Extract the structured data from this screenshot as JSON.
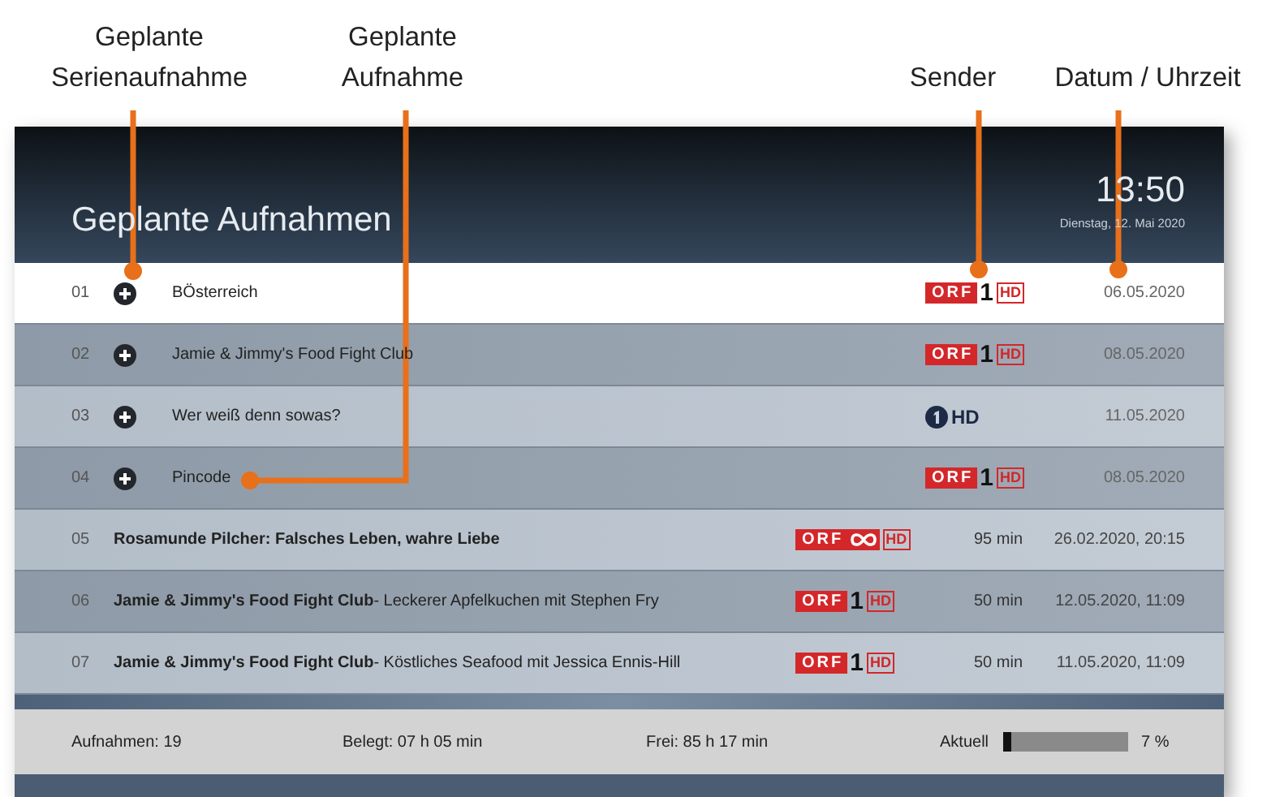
{
  "annotations": [
    {
      "label": "Geplante Serienaufnahme"
    },
    {
      "label": "Geplante Aufnahme"
    },
    {
      "label": "Sender"
    },
    {
      "label": "Datum / Uhrzeit"
    }
  ],
  "header": {
    "title": "Geplante Aufnahmen",
    "time": "13:50",
    "date": "Dienstag, 12. Mai 2020"
  },
  "rows": [
    {
      "kind": "series",
      "number": "01",
      "selected": true,
      "title": "BÖsterreich",
      "channel": {
        "kind": "orf1",
        "name": "ORF",
        "mark": "1",
        "hd": "HD"
      },
      "date": "06.05.2020"
    },
    {
      "kind": "series",
      "number": "02",
      "selected": false,
      "title": "Jamie & Jimmy's Food Fight Club",
      "channel": {
        "kind": "orf1",
        "name": "ORF",
        "mark": "1",
        "hd": "HD"
      },
      "date": "08.05.2020"
    },
    {
      "kind": "series",
      "number": "03",
      "selected": false,
      "title": "Wer weiß denn sowas?",
      "channel": {
        "kind": "ard",
        "hd": "HD"
      },
      "date": "11.05.2020"
    },
    {
      "kind": "series",
      "number": "04",
      "selected": false,
      "title": "Pincode",
      "channel": {
        "kind": "orf1",
        "name": "ORF",
        "mark": "1",
        "hd": "HD"
      },
      "date": "08.05.2020"
    },
    {
      "kind": "recording",
      "number": "05",
      "selected": false,
      "title": "Rosamunde Pilcher: Falsches Leben, wahre Liebe",
      "channel": {
        "kind": "orf3",
        "name": "ORF",
        "hd": "HD"
      },
      "duration": "95 min",
      "date": "26.02.2020, 20:15"
    },
    {
      "kind": "recording",
      "number": "06",
      "selected": false,
      "title": "Jamie & Jimmy's Food Fight Club",
      "episode": "- Leckerer Apfelkuchen mit Stephen Fry",
      "channel": {
        "kind": "orf1",
        "name": "ORF",
        "mark": "1",
        "hd": "HD"
      },
      "duration": "50 min",
      "date": "12.05.2020, 11:09"
    },
    {
      "kind": "recording",
      "number": "07",
      "selected": false,
      "title": "Jamie & Jimmy's Food Fight Club",
      "episode": "- Köstliches Seafood mit Jessica Ennis-Hill",
      "channel": {
        "kind": "orf1",
        "name": "ORF",
        "mark": "1",
        "hd": "HD"
      },
      "duration": "50 min",
      "date": "11.05.2020, 11:09"
    }
  ],
  "footer": {
    "recordings": "Aufnahmen: 19",
    "used": "Belegt: 07 h 05 min",
    "free": "Frei: 85 h 17 min",
    "usage_label": "Aktuell",
    "usage": {
      "level": 0.07
    },
    "usage_text": "7 %"
  }
}
